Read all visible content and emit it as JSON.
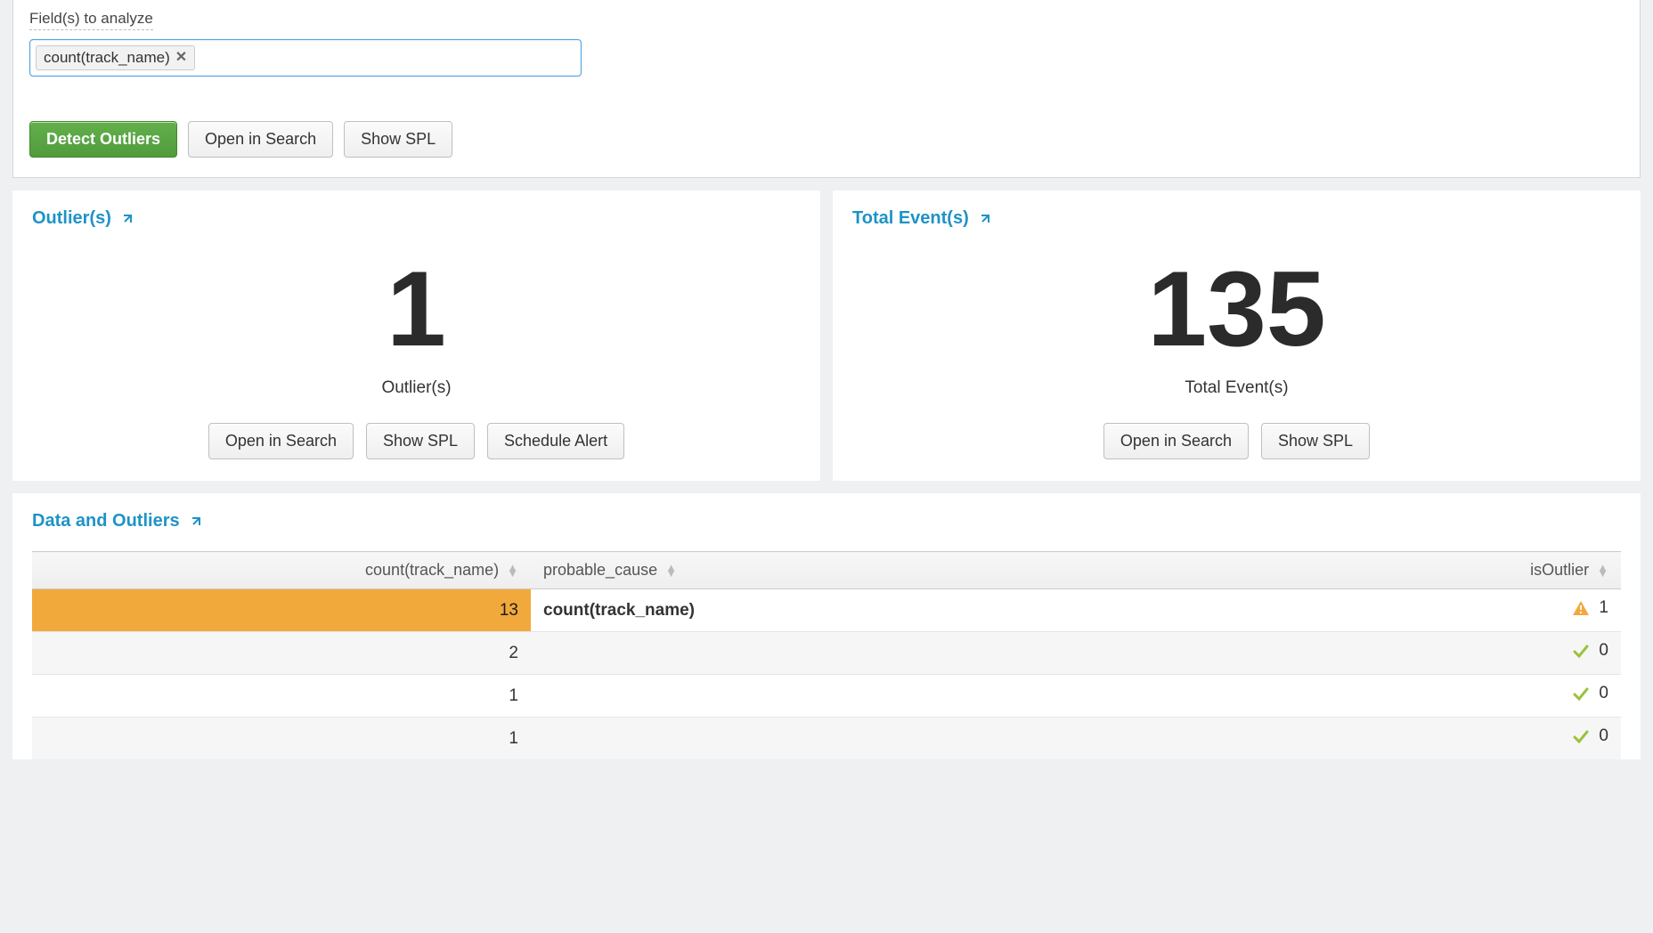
{
  "form": {
    "fields_label": "Field(s) to analyze",
    "token": "count(track_name)",
    "detect_btn": "Detect Outliers",
    "open_in_search_btn": "Open in Search",
    "show_spl_btn": "Show SPL"
  },
  "panels": {
    "outliers": {
      "title": "Outlier(s)",
      "value": "1",
      "label": "Outlier(s)",
      "open_in_search": "Open in Search",
      "show_spl": "Show SPL",
      "schedule_alert": "Schedule Alert"
    },
    "events": {
      "title": "Total Event(s)",
      "value": "135",
      "label": "Total Event(s)",
      "open_in_search": "Open in Search",
      "show_spl": "Show SPL"
    }
  },
  "table": {
    "title": "Data and Outliers",
    "headers": {
      "count": "count(track_name)",
      "cause": "probable_cause",
      "outlier": "isOutlier"
    },
    "rows": [
      {
        "count": "13",
        "cause": "count(track_name)",
        "outlier": "1",
        "warn": true,
        "highlight": true
      },
      {
        "count": "2",
        "cause": "",
        "outlier": "0",
        "warn": false,
        "highlight": false
      },
      {
        "count": "1",
        "cause": "",
        "outlier": "0",
        "warn": false,
        "highlight": false
      },
      {
        "count": "1",
        "cause": "",
        "outlier": "0",
        "warn": false,
        "highlight": false
      }
    ]
  }
}
